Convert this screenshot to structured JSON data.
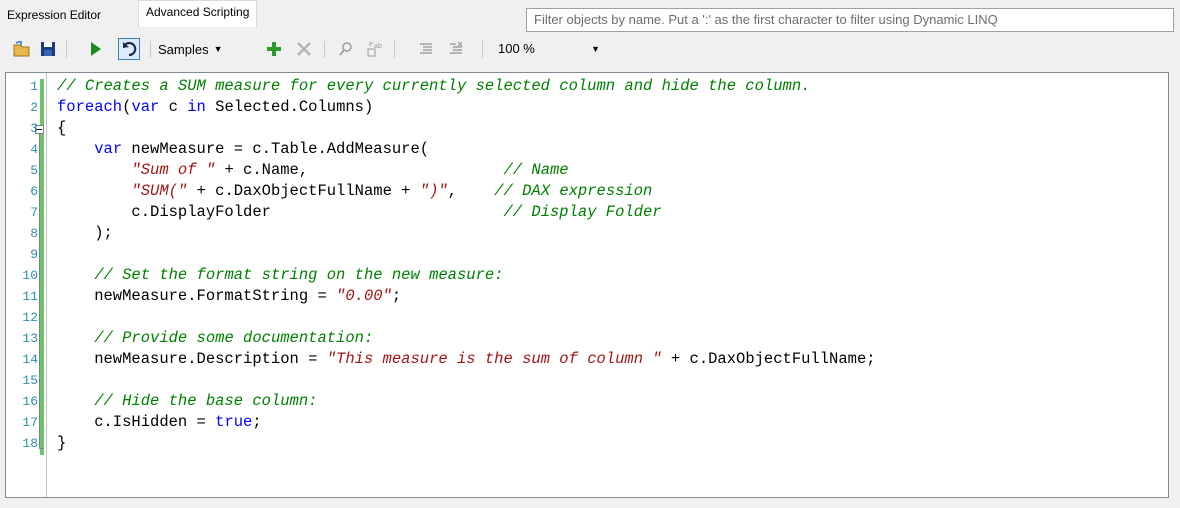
{
  "tabs": {
    "expression_editor": "Expression Editor",
    "advanced_scripting": "Advanced Scripting"
  },
  "filter": {
    "placeholder": "Filter objects by name. Put a ':' as the first character to filter using Dynamic LINQ"
  },
  "toolbar": {
    "samples_label": "Samples",
    "zoom_value": "100 %",
    "icons": [
      "open-folder-icon",
      "save-icon",
      "run-icon",
      "undo-icon",
      "samples-dropdown",
      "add-icon",
      "delete-icon",
      "find-icon",
      "replace-icon",
      "comment-icon",
      "uncomment-icon"
    ]
  },
  "editor": {
    "line_numbers": [
      "1",
      "2",
      "3",
      "4",
      "5",
      "6",
      "7",
      "8",
      "9",
      "10",
      "11",
      "12",
      "13",
      "14",
      "15",
      "16",
      "17",
      "18"
    ],
    "lines": [
      [
        {
          "t": "cm",
          "v": "// Creates a SUM measure for every currently selected column and hide the column."
        }
      ],
      [
        {
          "t": "kw",
          "v": "foreach"
        },
        {
          "t": "",
          "v": "("
        },
        {
          "t": "kw",
          "v": "var"
        },
        {
          "t": "",
          "v": " c "
        },
        {
          "t": "kw",
          "v": "in"
        },
        {
          "t": "",
          "v": " Selected.Columns)"
        }
      ],
      [
        {
          "t": "",
          "v": "{"
        }
      ],
      [
        {
          "t": "",
          "v": "    "
        },
        {
          "t": "kw",
          "v": "var"
        },
        {
          "t": "",
          "v": " newMeasure = c.Table.AddMeasure("
        }
      ],
      [
        {
          "t": "",
          "v": "        "
        },
        {
          "t": "st",
          "v": "\"Sum of \""
        },
        {
          "t": "",
          "v": " + c.Name,                     "
        },
        {
          "t": "cm",
          "v": "// Name"
        }
      ],
      [
        {
          "t": "",
          "v": "        "
        },
        {
          "t": "st",
          "v": "\"SUM(\""
        },
        {
          "t": "",
          "v": " + c.DaxObjectFullName + "
        },
        {
          "t": "st",
          "v": "\")\""
        },
        {
          "t": "",
          "v": ",    "
        },
        {
          "t": "cm",
          "v": "// DAX expression"
        }
      ],
      [
        {
          "t": "",
          "v": "        c.DisplayFolder                         "
        },
        {
          "t": "cm",
          "v": "// Display Folder"
        }
      ],
      [
        {
          "t": "",
          "v": "    );"
        }
      ],
      [
        {
          "t": "",
          "v": ""
        }
      ],
      [
        {
          "t": "",
          "v": "    "
        },
        {
          "t": "cm",
          "v": "// Set the format string on the new measure:"
        }
      ],
      [
        {
          "t": "",
          "v": "    newMeasure.FormatString = "
        },
        {
          "t": "st",
          "v": "\"0.00\""
        },
        {
          "t": "",
          "v": ";"
        }
      ],
      [
        {
          "t": "",
          "v": ""
        }
      ],
      [
        {
          "t": "",
          "v": "    "
        },
        {
          "t": "cm",
          "v": "// Provide some documentation:"
        }
      ],
      [
        {
          "t": "",
          "v": "    newMeasure.Description = "
        },
        {
          "t": "st",
          "v": "\"This measure is the sum of column \""
        },
        {
          "t": "",
          "v": " + c.DaxObjectFullName;"
        }
      ],
      [
        {
          "t": "",
          "v": ""
        }
      ],
      [
        {
          "t": "",
          "v": "    "
        },
        {
          "t": "cm",
          "v": "// Hide the base column:"
        }
      ],
      [
        {
          "t": "",
          "v": "    c.IsHidden = "
        },
        {
          "t": "kw",
          "v": "true"
        },
        {
          "t": "",
          "v": ";"
        }
      ],
      [
        {
          "t": "",
          "v": "}"
        }
      ]
    ]
  },
  "colors": {
    "comment": "#008000",
    "keyword": "#0000ff",
    "string": "#a31515",
    "line_number": "#2b91af",
    "change_bar": "#6cc36c"
  }
}
